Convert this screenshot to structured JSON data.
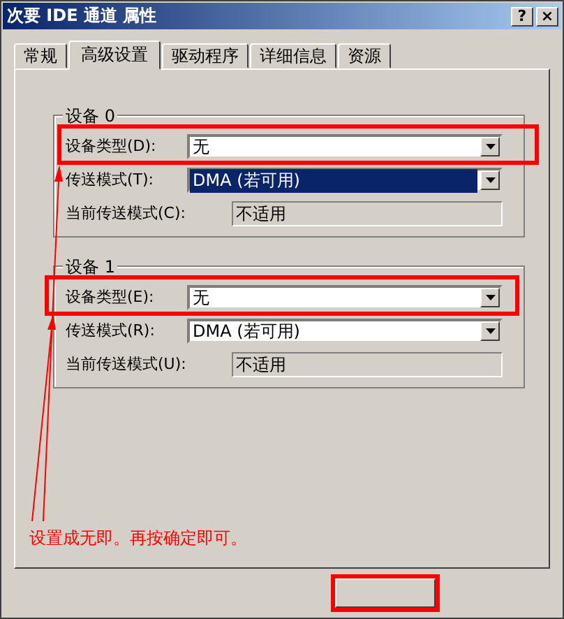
{
  "window": {
    "title": "次要 IDE 通道 属性",
    "title_buttons": [
      "?",
      "×"
    ]
  },
  "tabs": [
    {
      "label": "常规",
      "selected": false
    },
    {
      "label": "高级设置",
      "selected": true
    },
    {
      "label": "驱动程序",
      "selected": false
    },
    {
      "label": "详细信息",
      "selected": false
    },
    {
      "label": "资源",
      "selected": false
    }
  ],
  "groups": [
    {
      "legend": "设备 0",
      "fields": [
        {
          "kind": "combo",
          "label": "设备类型(D):",
          "value": "无",
          "focused": false,
          "highlighted": true
        },
        {
          "kind": "combo",
          "label": "传送模式(T):",
          "value": "DMA (若可用)",
          "focused": true,
          "highlighted": false
        },
        {
          "kind": "readonly",
          "label": "当前传送模式(C):",
          "value": "不适用",
          "highlighted": false
        }
      ]
    },
    {
      "legend": "设备 1",
      "fields": [
        {
          "kind": "combo",
          "label": "设备类型(E):",
          "value": "无",
          "focused": false,
          "highlighted": true
        },
        {
          "kind": "combo",
          "label": "传送模式(R):",
          "value": "DMA (若可用)",
          "focused": false,
          "highlighted": false
        },
        {
          "kind": "readonly",
          "label": "当前传送模式(U):",
          "value": "不适用",
          "highlighted": false
        }
      ]
    }
  ],
  "annotation": {
    "text": "设置成无即。再按确定即可。"
  }
}
